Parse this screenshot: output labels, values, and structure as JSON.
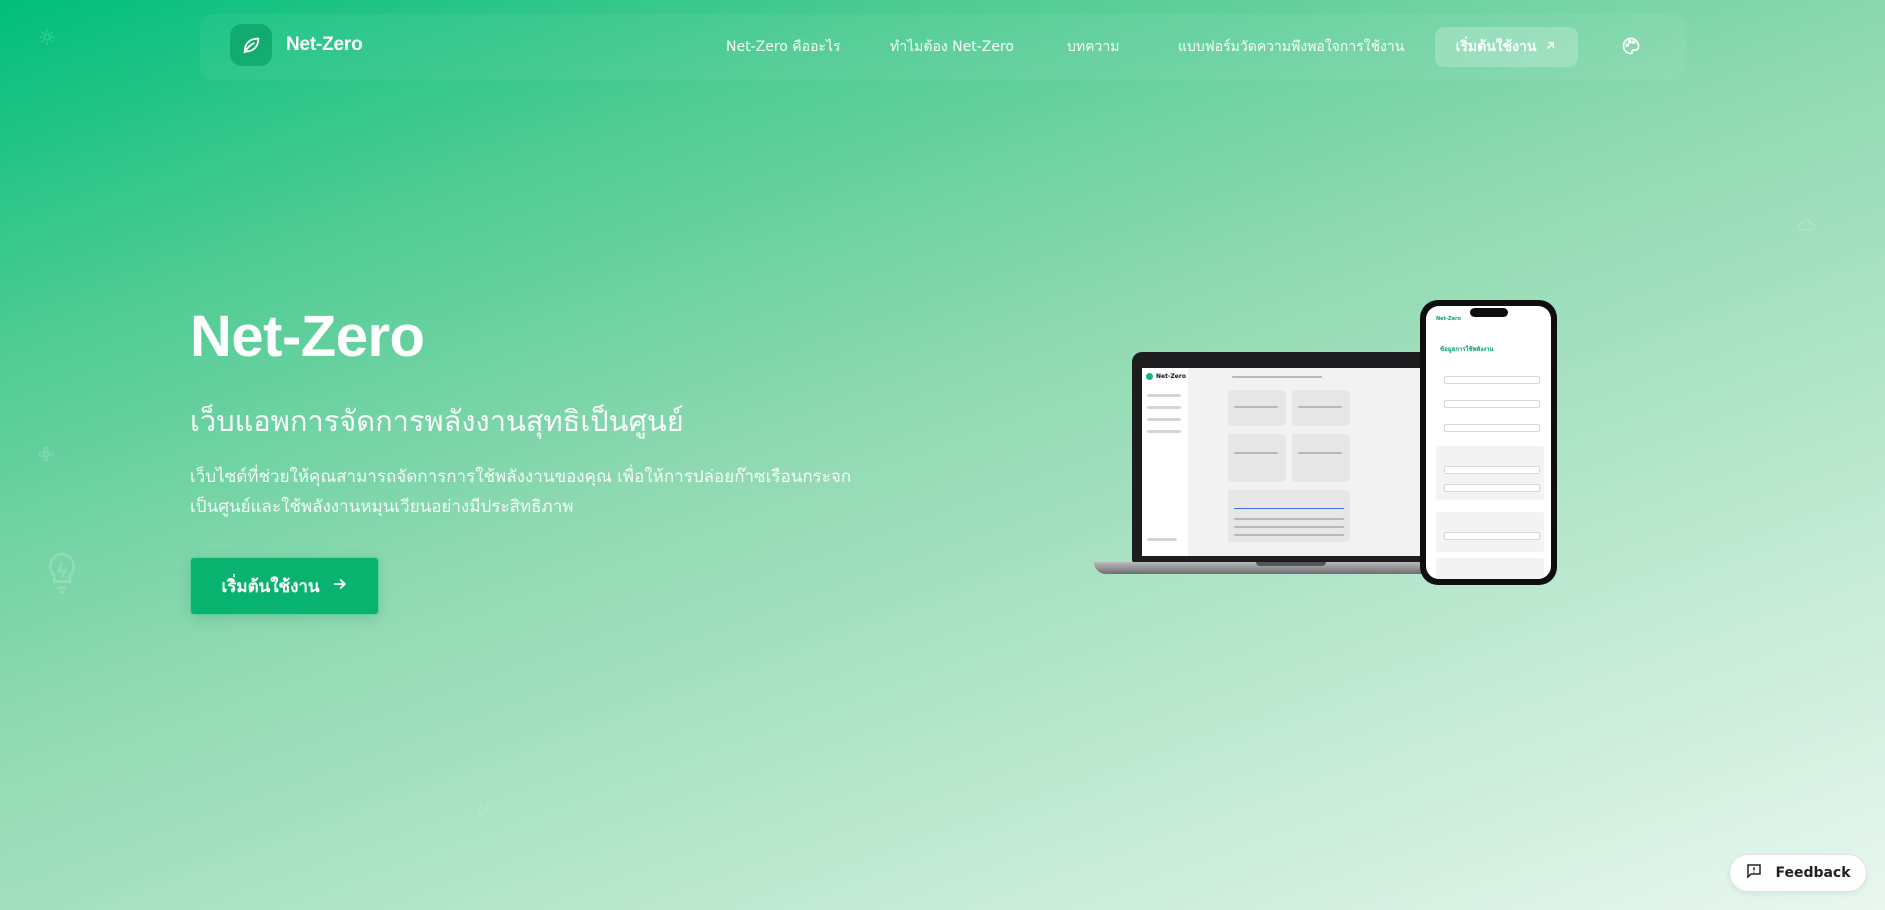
{
  "brand": {
    "name": "Net-Zero",
    "logo_icon": "leaf-icon"
  },
  "nav": {
    "links": [
      "Net-Zero คืออะไร",
      "ทำไมต้อง Net-Zero",
      "บทความ",
      "แบบฟอร์มวัดความพึงพอใจการใช้งาน"
    ],
    "cta_label": "เริ่มต้นใช้งาน",
    "cta_icon": "arrow-up-right-icon",
    "theme_icon": "palette-icon"
  },
  "hero": {
    "title": "Net-Zero",
    "subtitle": "เว็บแอพการจัดการพลังงานสุทธิเป็นศูนย์",
    "description_line1": "เว็บไซต์ที่ช่วยให้คุณสามารถจัดการการใช้พลังงานของคุณ เพื่อให้การปล่อยก๊าซเรือนกระจก",
    "description_line2": "เป็นศูนย์และใช้พลังงานหมุนเวียนอย่างมีประสิทธิภาพ",
    "cta_label": "เริ่มต้นใช้งาน",
    "cta_icon": "arrow-right-icon"
  },
  "mockup": {
    "laptop_brand": "Net-Zero",
    "phone_title": "ข้อมูลการใช้พลังงาน",
    "phone_brand": "Net-Zero"
  },
  "feedback": {
    "label": "Feedback",
    "icon": "feedback-icon"
  },
  "colors": {
    "accent": "#08b36f",
    "gradient_start": "#00be7c",
    "gradient_end": "#e9f7ef"
  }
}
